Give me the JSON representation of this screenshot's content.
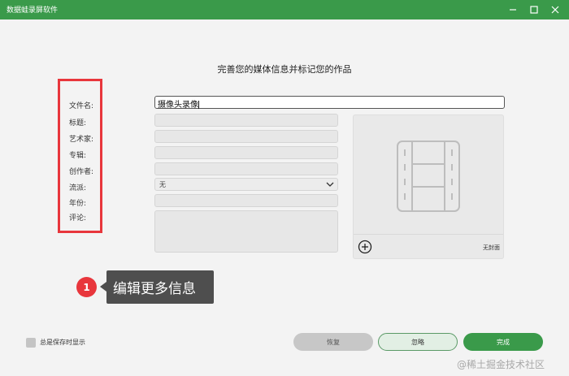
{
  "window": {
    "title": "数据蛙录屏软件",
    "controls": [
      "minimize-icon",
      "maximize-icon",
      "close-icon"
    ],
    "accent": "#3a9a4a"
  },
  "heading": "完善您的媒体信息并标记您的作品",
  "labels": {
    "filename": "文件名:",
    "title": "标题:",
    "artist": "艺术家:",
    "album": "专辑:",
    "creator": "创作者:",
    "genre": "流派:",
    "year": "年份:",
    "comment": "评论:"
  },
  "fields": {
    "filename_value": "摄像头录像",
    "title_value": "",
    "artist_value": "",
    "album_value": "",
    "creator_value": "",
    "genre_selected": "无",
    "year_value": "",
    "comment_value": ""
  },
  "cover": {
    "no_cover_label": "无封面",
    "icons": [
      "film-placeholder-icon",
      "add-circle-icon"
    ]
  },
  "tip": {
    "number": "1",
    "text": "编辑更多信息",
    "highlight_color": "#e8363c"
  },
  "footer": {
    "always_show_label": "总是保存时显示",
    "always_show_checked": false,
    "restore_label": "恢复",
    "ignore_label": "忽略",
    "done_label": "完成"
  },
  "watermark": "@稀土掘金技术社区"
}
